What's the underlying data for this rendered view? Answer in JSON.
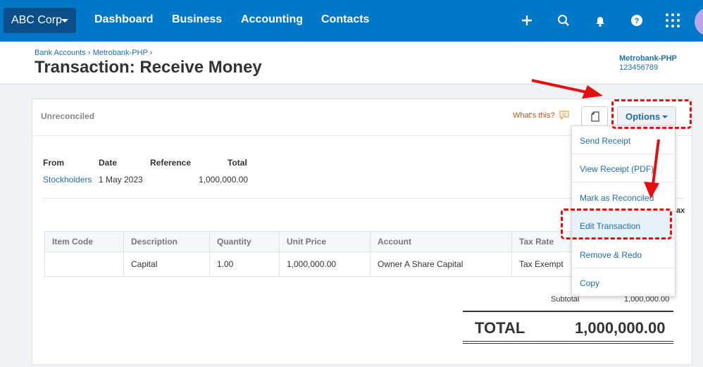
{
  "nav": {
    "org": "ABC Corp",
    "links": [
      "Dashboard",
      "Business",
      "Accounting",
      "Contacts"
    ],
    "icons": [
      "plus-icon",
      "search-icon",
      "bell-icon",
      "help-icon",
      "apps-grid-icon"
    ]
  },
  "header": {
    "breadcrumb": [
      "Bank Accounts",
      "Metrobank-PHP"
    ],
    "title": "Transaction: Receive Money",
    "account_name": "Metrobank-PHP",
    "account_number": "123456789"
  },
  "toolbar": {
    "status": "Unreconciled",
    "whats_this": "What's this?",
    "options_label": "Options"
  },
  "meta": {
    "from_label": "From",
    "from_value": "Stockholders",
    "date_label": "Date",
    "date_value": "1 May 2023",
    "reference_label": "Reference",
    "total_label": "Total",
    "total_value": "1,000,000.00",
    "cut_text": "ax"
  },
  "table": {
    "headers": [
      "Item Code",
      "Description",
      "Quantity",
      "Unit Price",
      "Account",
      "Tax Rate"
    ],
    "rows": [
      [
        "",
        "Capital",
        "1.00",
        "1,000,000.00",
        "Owner A Share Capital",
        "Tax Exempt"
      ]
    ]
  },
  "totals": {
    "subtotal_label": "Subtotal",
    "subtotal_value": "1,000,000.00",
    "total_label": "TOTAL",
    "total_value": "1,000,000.00"
  },
  "menu": [
    "Send Receipt",
    "View Receipt (PDF)",
    "Mark as Reconciled",
    "Edit Transaction",
    "Remove & Redo",
    "Copy"
  ],
  "colors": {
    "brand": "#0078c8",
    "link": "#1f6ea8",
    "annotation": "#e41010"
  }
}
